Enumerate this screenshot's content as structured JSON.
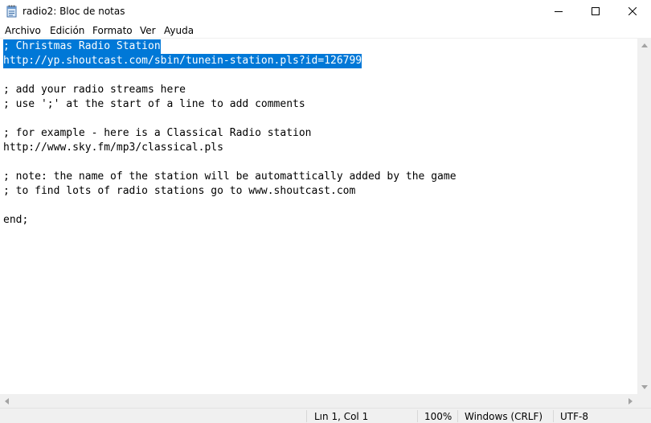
{
  "window": {
    "title": "radio2: Bloc de notas",
    "icon": "notepad-icon"
  },
  "menu": {
    "items": [
      {
        "label": "Archivo"
      },
      {
        "label": "Edición"
      },
      {
        "label": "Formato"
      },
      {
        "label": "Ver"
      },
      {
        "label": "Ayuda"
      }
    ]
  },
  "editor": {
    "lines": [
      "; Christmas Radio Station",
      "http://yp.shoutcast.com/sbin/tunein-station.pls?id=126799",
      "",
      "; add your radio streams here",
      "; use ';' at the start of a line to add comments",
      "",
      "; for example - here is a Classical Radio station",
      "http://www.sky.fm/mp3/classical.pls",
      "",
      "; note: the name of the station will be automattically added by the game",
      "; to find lots of radio stations go to www.shoutcast.com",
      "",
      "end;"
    ],
    "selected_lines": [
      0,
      1
    ],
    "selection_color": "#0078d7"
  },
  "status": {
    "position": "Lın 1, Col 1",
    "zoom": "100%",
    "line_ending": "Windows (CRLF)",
    "encoding": "UTF-8"
  }
}
